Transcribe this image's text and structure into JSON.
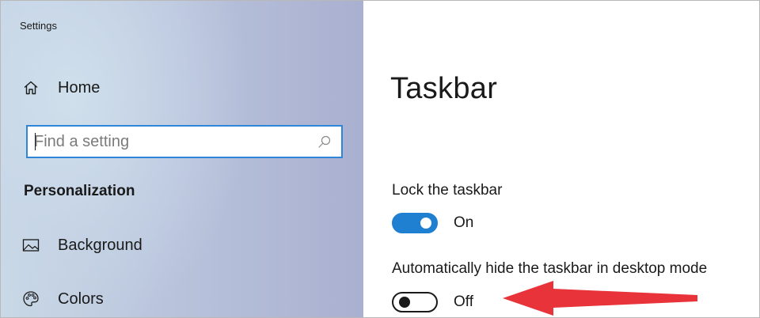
{
  "window": {
    "title": "Settings"
  },
  "sidebar": {
    "home": {
      "label": "Home",
      "icon": "home-icon"
    },
    "search": {
      "placeholder": "Find a setting",
      "icon": "search-icon"
    },
    "section_header": "Personalization",
    "items": [
      {
        "label": "Background",
        "icon": "image-icon"
      },
      {
        "label": "Colors",
        "icon": "palette-icon"
      }
    ]
  },
  "main": {
    "title": "Taskbar",
    "settings": [
      {
        "label": "Lock the taskbar",
        "state_label": "On",
        "enabled": true
      },
      {
        "label": "Automatically hide the taskbar in desktop mode",
        "state_label": "Off",
        "enabled": false
      }
    ]
  },
  "colors": {
    "accent": "#1f7fd0",
    "annotation_arrow": "#e8333a"
  }
}
